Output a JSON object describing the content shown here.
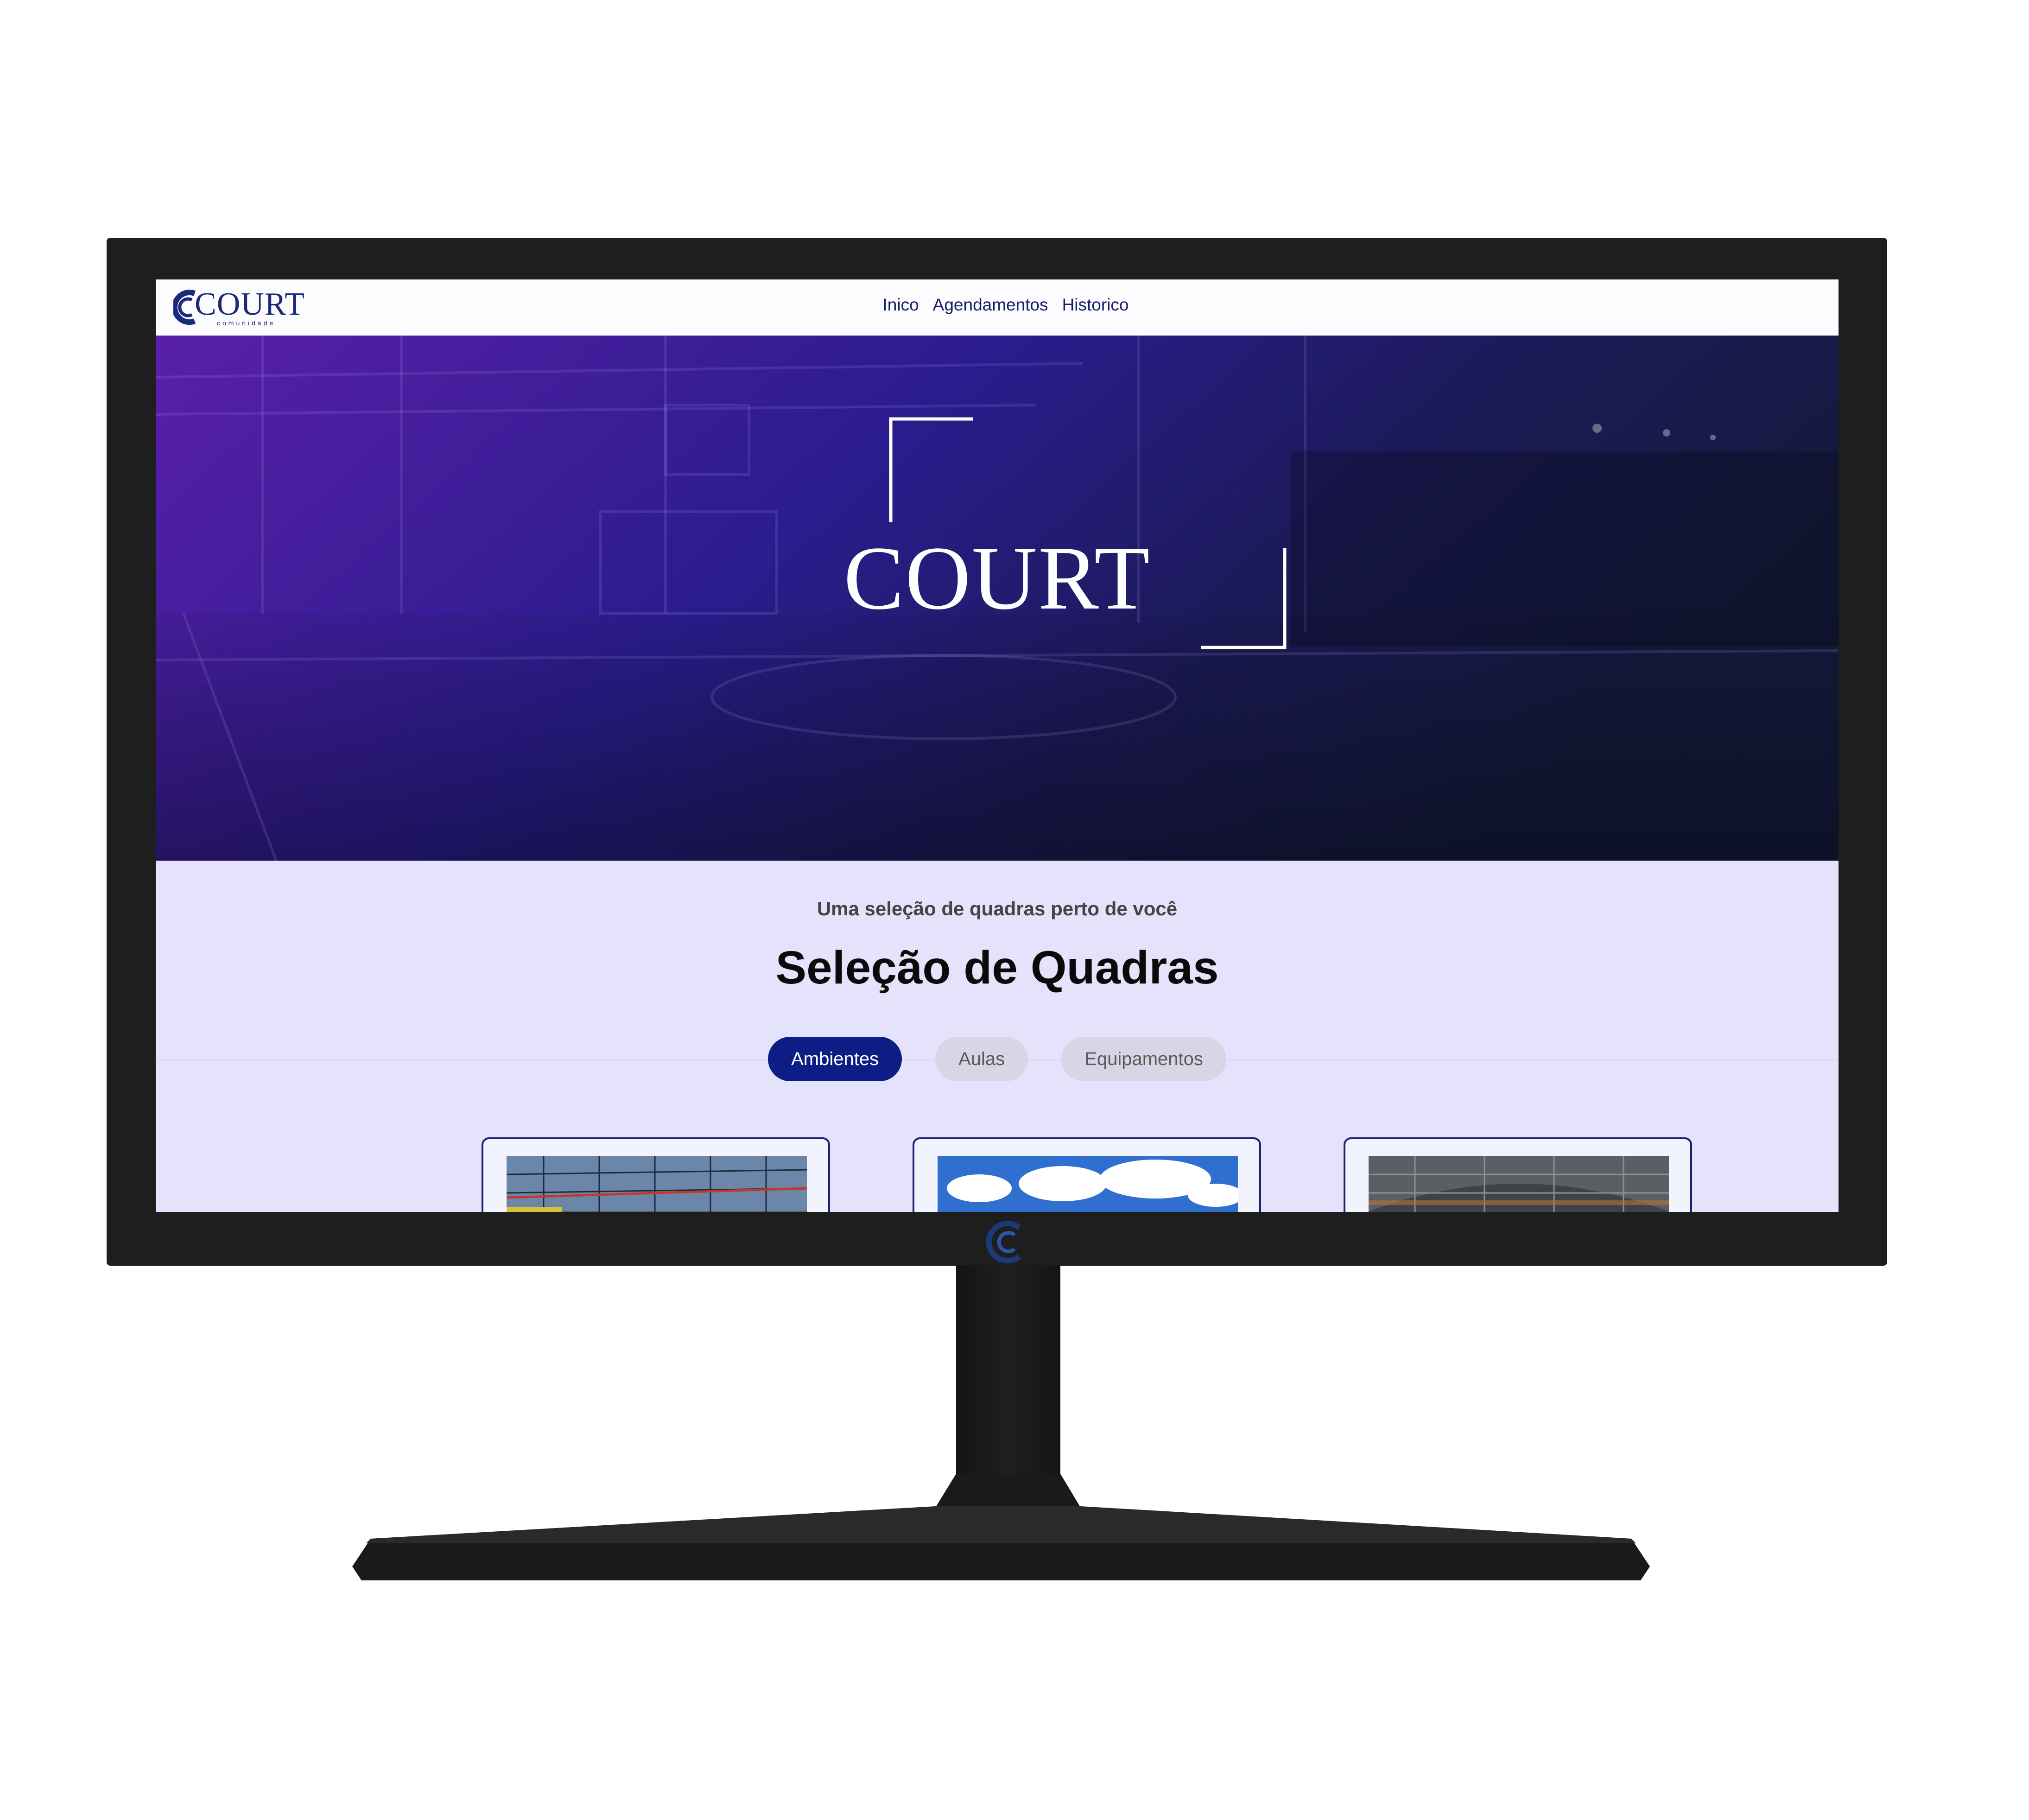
{
  "screen": {
    "brand": {
      "logo_text": "COURT",
      "logo_subtext": "comunidade"
    },
    "nav": {
      "items": [
        {
          "label": "Inico"
        },
        {
          "label": "Agendamentos"
        },
        {
          "label": "Historico"
        }
      ]
    },
    "hero": {
      "title": "COURT"
    },
    "section": {
      "subtitle": "Uma seleção de quadras perto de você",
      "title": "Seleção de Quadras",
      "tabs": [
        {
          "label": "Ambientes",
          "active": true
        },
        {
          "label": "Aulas",
          "active": false
        },
        {
          "label": "Equipamentos",
          "active": false
        }
      ]
    },
    "cards": [
      {
        "image": "court-netting-photo"
      },
      {
        "image": "blue-sky-photo"
      },
      {
        "image": "covered-arena-roof-photo"
      }
    ]
  },
  "colors": {
    "nav_text": "#15206a",
    "active_tab": "#0d1d86",
    "inactive_tab": "#d7d6e6",
    "section_background": "#e4e3fb",
    "hero_gradient": [
      "#5a1fa8",
      "#2a1c8e",
      "#141a3c"
    ],
    "monitor_bezel": "#1e1e1e"
  }
}
